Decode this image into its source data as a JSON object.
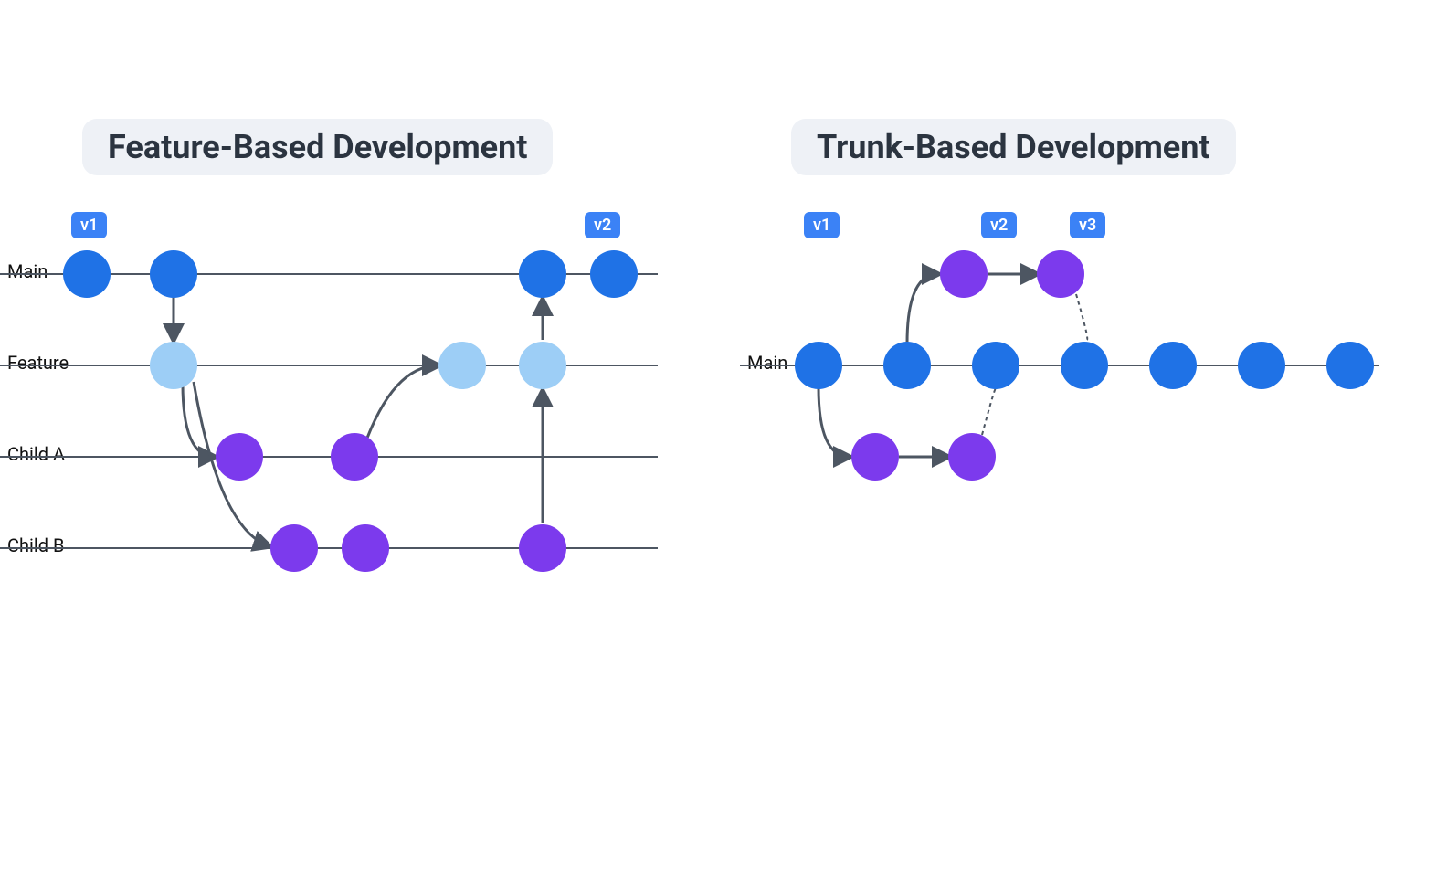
{
  "left": {
    "title": "Feature-Based Development",
    "tags": {
      "v1": "v1",
      "v2": "v2"
    },
    "lanes": {
      "main": "Main",
      "feature": "Feature",
      "childA": "Child A",
      "childB": "Child B"
    }
  },
  "right": {
    "title": "Trunk-Based Development",
    "tags": {
      "v1": "v1",
      "v2": "v2",
      "v3": "v3"
    },
    "lanes": {
      "main": "Main"
    }
  },
  "colors": {
    "blue": "#1f72e6",
    "lightblue": "#9dcef6",
    "purple": "#7c3aed",
    "lane": "#4d5662",
    "arrow": "#4d5662"
  },
  "chart_data": {
    "type": "diagram",
    "description": "Two git branching diagrams side by side comparing Feature-Based Development (multiple long-lived lanes) with Trunk-Based Development (single main lane with short-lived branches).",
    "left_diagram": {
      "model": "Feature-Based Development",
      "lanes": [
        "Main",
        "Feature",
        "Child A",
        "Child B"
      ],
      "version_tags": [
        {
          "label": "v1",
          "lane": "Main",
          "commit_index": 0
        },
        {
          "label": "v2",
          "lane": "Main",
          "commit_index": 3
        }
      ],
      "commits": [
        {
          "lane": "Main",
          "x": 0,
          "color": "blue"
        },
        {
          "lane": "Main",
          "x": 1,
          "color": "blue"
        },
        {
          "lane": "Main",
          "x": 5,
          "color": "blue"
        },
        {
          "lane": "Main",
          "x": 6,
          "color": "blue"
        },
        {
          "lane": "Feature",
          "x": 1,
          "color": "lightblue"
        },
        {
          "lane": "Feature",
          "x": 4,
          "color": "lightblue"
        },
        {
          "lane": "Feature",
          "x": 5,
          "color": "lightblue"
        },
        {
          "lane": "Child A",
          "x": 2,
          "color": "purple"
        },
        {
          "lane": "Child A",
          "x": 3,
          "color": "purple"
        },
        {
          "lane": "Child B",
          "x": 2,
          "color": "purple"
        },
        {
          "lane": "Child B",
          "x": 3,
          "color": "purple"
        },
        {
          "lane": "Child B",
          "x": 5,
          "color": "purple"
        }
      ],
      "arrows": [
        {
          "from": [
            "Main",
            1
          ],
          "to": [
            "Feature",
            1
          ]
        },
        {
          "from": [
            "Feature",
            1
          ],
          "to": [
            "Child A",
            2
          ]
        },
        {
          "from": [
            "Feature",
            1
          ],
          "to": [
            "Child B",
            2
          ]
        },
        {
          "from": [
            "Child A",
            3
          ],
          "to": [
            "Feature",
            4
          ]
        },
        {
          "from": [
            "Child B",
            5
          ],
          "to": [
            "Feature",
            5
          ]
        },
        {
          "from": [
            "Feature",
            5
          ],
          "to": [
            "Main",
            5
          ]
        }
      ]
    },
    "right_diagram": {
      "model": "Trunk-Based Development",
      "lanes": [
        "Main"
      ],
      "version_tags": [
        {
          "label": "v1",
          "lane": "Main",
          "commit_index": 0
        },
        {
          "label": "v2",
          "lane": "Main",
          "commit_index": 2
        },
        {
          "label": "v3",
          "lane": "Main",
          "commit_index": 3
        }
      ],
      "main_commits": 7,
      "short_branches": [
        {
          "from_commit": 0,
          "merge_commit": 2,
          "direction": "below",
          "commits": 2
        },
        {
          "from_commit": 1,
          "merge_commit": 3,
          "direction": "above",
          "commits": 2
        }
      ]
    }
  }
}
